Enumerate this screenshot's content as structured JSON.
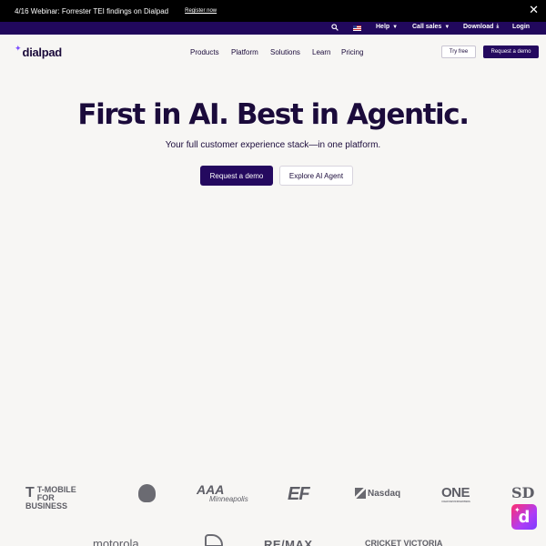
{
  "announcement": {
    "message": "4/16 Webinar: Forrester TEI findings on Dialpad",
    "link": "Register now",
    "close": "✕"
  },
  "utility_nav": {
    "help": "Help",
    "call_sales": "Call sales",
    "download": "Download",
    "login": "Login"
  },
  "nav": {
    "brand": "dialpad",
    "items": [
      "Products",
      "Platform",
      "Solutions",
      "Learn",
      "Pricing"
    ],
    "try_free": "Try free",
    "request_demo": "Request a demo"
  },
  "hero": {
    "title": "First in AI. Best in Agentic.",
    "subtitle": "Your full customer experience stack—in one platform.",
    "primary_cta": "Request a demo",
    "secondary_cta": "Explore AI Agent"
  },
  "customer_logos": {
    "tmobile_line1": "T-MOBILE",
    "tmobile_line2": "FOR BUSINESS",
    "aaa": "AAA",
    "aaa_sub": "Minneapolis",
    "ef": "EF",
    "nasdaq": "Nasdaq",
    "one": "ONE",
    "one_sub": "OCEAN NETWORK EXPRESS",
    "padres": "SD",
    "motorola": "motorola",
    "remax": "RE/MAX",
    "cricket": "CRICKET VICTORIA"
  },
  "chat_widget": {
    "letter": "d"
  },
  "colors": {
    "brand": "#24095f",
    "utility_bar": "#21085c",
    "background": "#f7f6f4"
  }
}
